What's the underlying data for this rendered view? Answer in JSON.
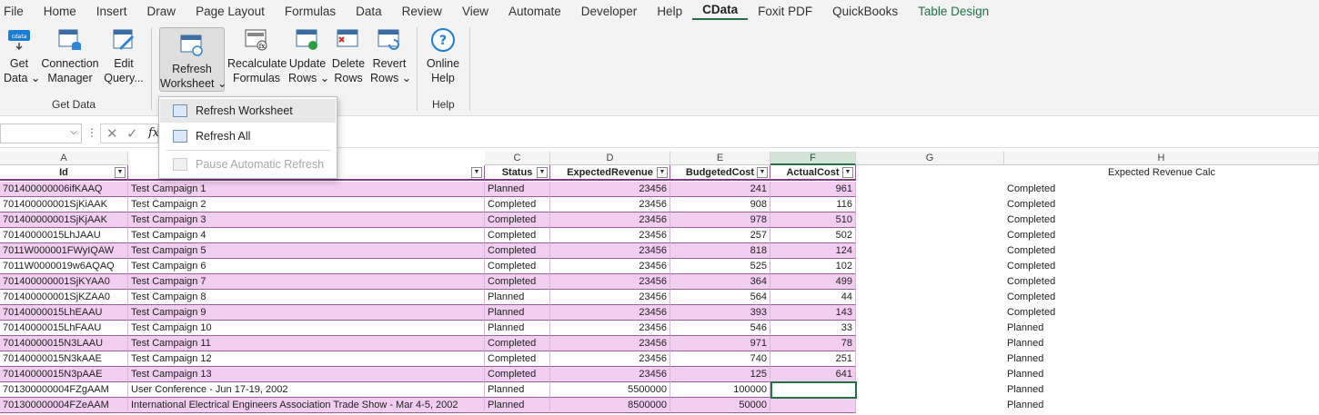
{
  "menu": [
    "File",
    "Home",
    "Insert",
    "Draw",
    "Page Layout",
    "Formulas",
    "Data",
    "Review",
    "View",
    "Automate",
    "Developer",
    "Help",
    "CData",
    "Foxit PDF",
    "QuickBooks",
    "Table Design"
  ],
  "ribbon": {
    "get_data": [
      "Get",
      "Data ⌄"
    ],
    "connection_manager": [
      "Connection",
      "Manager"
    ],
    "edit_query": [
      "Edit",
      "Query..."
    ],
    "group_get_data": "Get Data",
    "refresh_worksheet": [
      "Refresh",
      "Worksheet ⌄"
    ],
    "recalculate": [
      "Recalculate",
      "Formulas"
    ],
    "update_rows": [
      "Update",
      "Rows ⌄"
    ],
    "delete_rows": [
      "Delete",
      "Rows"
    ],
    "revert_rows": [
      "Revert",
      "Rows ⌄"
    ],
    "online_help": [
      "Online",
      "Help"
    ],
    "group_help": "Help"
  },
  "dropdown": {
    "refresh_worksheet": "Refresh Worksheet",
    "refresh_all": "Refresh All",
    "pause_refresh": "Pause Automatic Refresh"
  },
  "formula_bar": {
    "fx": "fx"
  },
  "columns": [
    "A",
    "C",
    "D",
    "E",
    "F",
    "G",
    "H"
  ],
  "headers": {
    "id": "Id",
    "status": "Status",
    "expected_revenue": "ExpectedRevenue",
    "budgeted_cost": "BudgetedCost",
    "actual_cost": "ActualCost",
    "calc": "Expected Revenue Calc"
  },
  "rows": [
    {
      "id": "701400000006ifKAAQ",
      "name": "Test Campaign 1",
      "status": "Planned",
      "expected": "23456",
      "budgeted": "241",
      "actual": "961",
      "calc": "Completed"
    },
    {
      "id": "701400000001SjKiAAK",
      "name": "Test Campaign 2",
      "status": "Completed",
      "expected": "23456",
      "budgeted": "908",
      "actual": "116",
      "calc": "Completed"
    },
    {
      "id": "701400000001SjKjAAK",
      "name": "Test Campaign 3",
      "status": "Completed",
      "expected": "23456",
      "budgeted": "978",
      "actual": "510",
      "calc": "Completed"
    },
    {
      "id": "70140000015LhJAAU",
      "name": "Test Campaign 4",
      "status": "Completed",
      "expected": "23456",
      "budgeted": "257",
      "actual": "502",
      "calc": "Completed"
    },
    {
      "id": "7011W000001FWyIQAW",
      "name": "Test Campaign 5",
      "status": "Completed",
      "expected": "23456",
      "budgeted": "818",
      "actual": "124",
      "calc": "Completed"
    },
    {
      "id": "7011W0000019w6AQAQ",
      "name": "Test Campaign 6",
      "status": "Completed",
      "expected": "23456",
      "budgeted": "525",
      "actual": "102",
      "calc": "Completed"
    },
    {
      "id": "701400000001SjKYAA0",
      "name": "Test Campaign 7",
      "status": "Completed",
      "expected": "23456",
      "budgeted": "364",
      "actual": "499",
      "calc": "Completed"
    },
    {
      "id": "701400000001SjKZAA0",
      "name": "Test Campaign 8",
      "status": "Planned",
      "expected": "23456",
      "budgeted": "564",
      "actual": "44",
      "calc": "Completed"
    },
    {
      "id": "70140000015LhEAAU",
      "name": "Test Campaign 9",
      "status": "Planned",
      "expected": "23456",
      "budgeted": "393",
      "actual": "143",
      "calc": "Completed"
    },
    {
      "id": "70140000015LhFAAU",
      "name": "Test Campaign 10",
      "status": "Planned",
      "expected": "23456",
      "budgeted": "546",
      "actual": "33",
      "calc": "Planned"
    },
    {
      "id": "70140000015N3LAAU",
      "name": "Test Campaign 11",
      "status": "Completed",
      "expected": "23456",
      "budgeted": "971",
      "actual": "78",
      "calc": "Planned"
    },
    {
      "id": "70140000015N3kAAE",
      "name": "Test Campaign 12",
      "status": "Completed",
      "expected": "23456",
      "budgeted": "740",
      "actual": "251",
      "calc": "Planned"
    },
    {
      "id": "70140000015N3pAAE",
      "name": "Test Campaign 13",
      "status": "Completed",
      "expected": "23456",
      "budgeted": "125",
      "actual": "641",
      "calc": "Planned"
    },
    {
      "id": "701300000004FZgAAM",
      "name": "User Conference - Jun 17-19, 2002",
      "status": "Planned",
      "expected": "5500000",
      "budgeted": "100000",
      "actual": "",
      "calc": "Planned"
    },
    {
      "id": "701300000004FZeAAM",
      "name": "International Electrical Engineers Association Trade Show - Mar 4-5, 2002",
      "status": "Planned",
      "expected": "8500000",
      "budgeted": "50000",
      "actual": "",
      "calc": "Planned"
    }
  ],
  "colors": {
    "band": "#f1cdf0",
    "band_border": "#9a5e9e",
    "accent": "#217346"
  }
}
